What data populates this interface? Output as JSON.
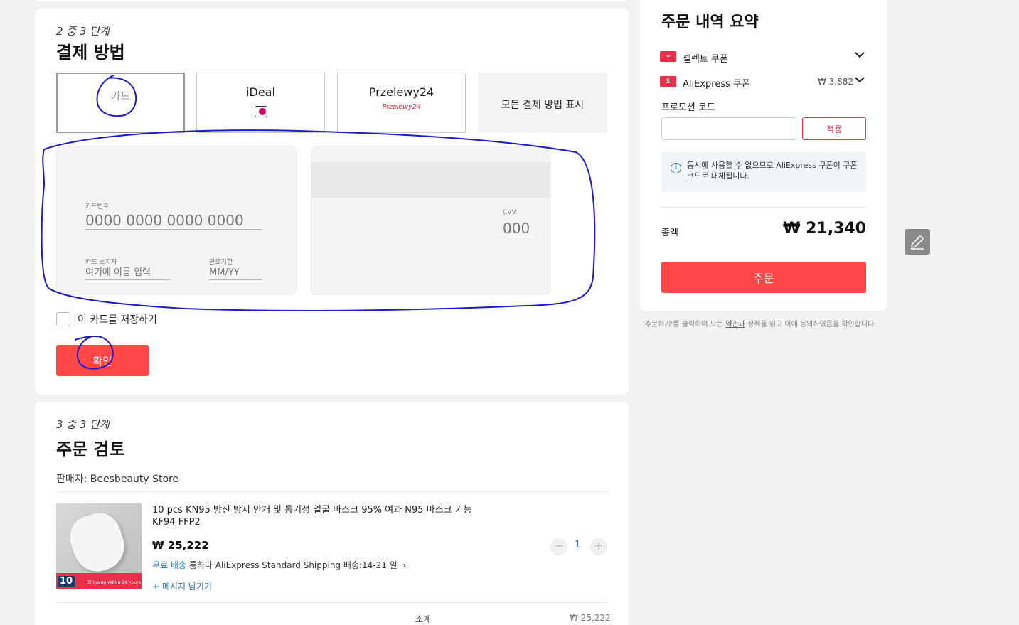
{
  "payment": {
    "step": "2 중 3 단계",
    "title": "결제 방법",
    "methods": [
      {
        "label": "카드"
      },
      {
        "label": "iDeal"
      },
      {
        "label": "Przelewy24",
        "logo_text": "Przelewy24"
      },
      {
        "label": "모든 결제 방법 표시"
      }
    ],
    "card_form": {
      "number_label": "카드번호",
      "number_placeholder": "0000 0000 0000 0000",
      "holder_label": "카드 소지자",
      "holder_placeholder": "여기에 이름 입력",
      "expiry_label": "만료기한",
      "expiry_placeholder": "MM/YY",
      "cvv_label": "CVV",
      "cvv_placeholder": "000"
    },
    "save_card_label": "이 카드를 저장하기",
    "confirm_label": "확인"
  },
  "review": {
    "step": "3 중 3 단계",
    "title": "주문 검토",
    "seller": "판매자: Beesbeauty Store",
    "product": {
      "title": "10 pcs KN95 방진 방지 안개 및 통기성 얼굴 마스크 95% 여과 N95 마스크 기능 KF94 FFP2",
      "price": "₩ 25,222",
      "quantity": "1",
      "shipping_free": "무료 배송",
      "shipping_rest": "통하다 AliExpress Standard Shipping 배송:14-21 일",
      "message_link": "+ 메시지 남기기",
      "image_badge": "10",
      "image_caption": "Shipping within 24 hours"
    },
    "subtotal_label": "소계",
    "subtotal_value": "₩ 25,222"
  },
  "summary": {
    "title": "주문 내역 요약",
    "select_coupon": "셀렉트 쿠폰",
    "ali_coupon": "AliExpress 쿠폰",
    "ali_coupon_amount": "-₩ 3,882",
    "promo_label": "프로모션 코드",
    "apply_label": "적용",
    "info_text": "동시에 사용할 수 없으므로 AliExpress 쿠폰이 쿠폰 코드로 대체됩니다.",
    "total_label": "총액",
    "total_value": "₩ 21,340",
    "order_label": "주문",
    "terms_before": "'주문하기'를 클릭하여 모든 ",
    "terms_link": "약관과",
    "terms_after": " 정책을 읽고 이에 동의하였음을 확인합니다."
  },
  "colors": {
    "accent": "#ff4747",
    "link": "#2a7ab8",
    "annotation": "#1a1acc"
  },
  "icons": [
    "ideal-logo-icon",
    "chevron-down-icon",
    "coupon-icon",
    "info-icon",
    "edit-pencil-icon",
    "minus-icon",
    "plus-icon",
    "chevron-right-icon"
  ]
}
